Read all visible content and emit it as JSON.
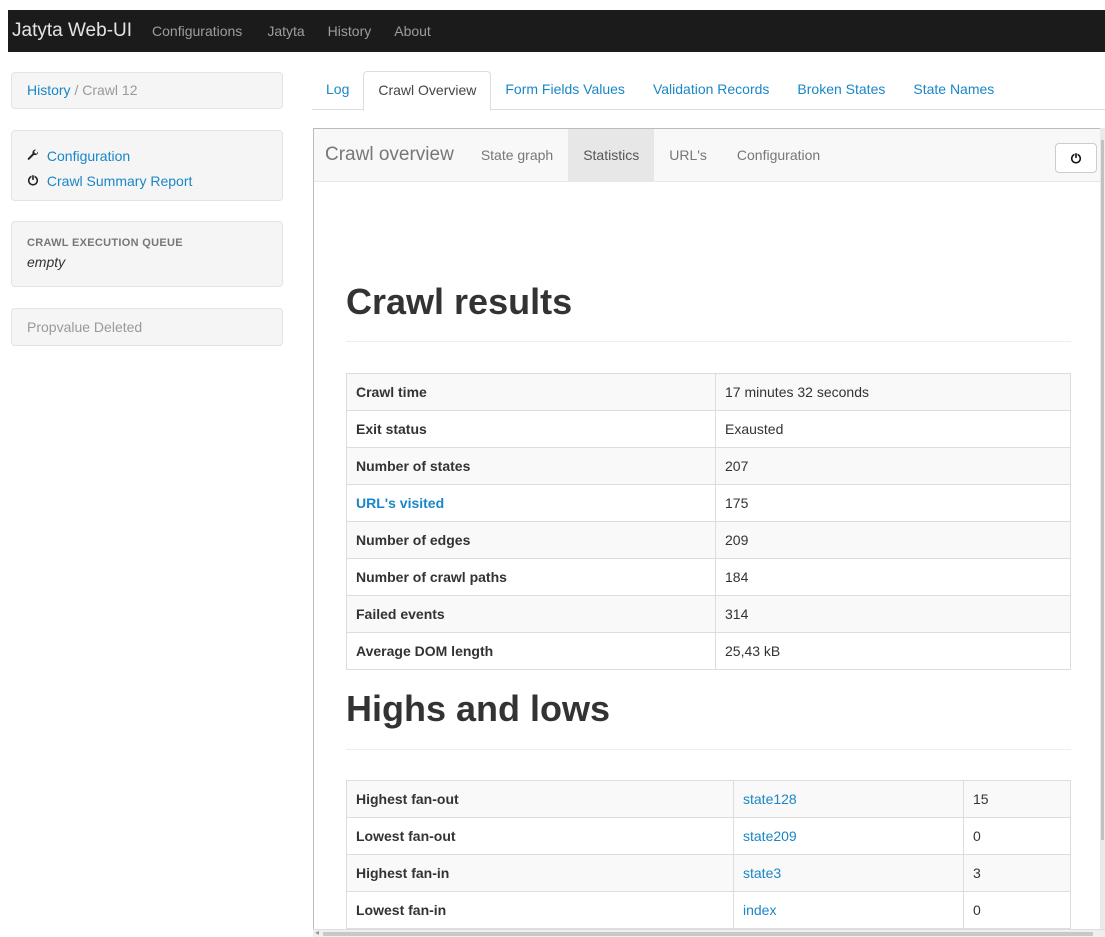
{
  "navbar": {
    "brand": "Jatyta Web-UI",
    "links": [
      "Configurations",
      "Jatyta",
      "History",
      "About"
    ]
  },
  "sidebar": {
    "breadcrumb": {
      "link": "History",
      "separator": "/",
      "current": "Crawl 12"
    },
    "links": [
      {
        "icon": "wrench-icon",
        "label": "Configuration"
      },
      {
        "icon": "power-icon",
        "label": "Crawl Summary Report"
      }
    ],
    "queue": {
      "header": "CRAWL EXECUTION QUEUE",
      "value": "empty"
    },
    "status_message": "Propvalue Deleted"
  },
  "tabs": [
    "Log",
    "Crawl Overview",
    "Form Fields Values",
    "Validation Records",
    "Broken States",
    "State Names"
  ],
  "active_tab": "Crawl Overview",
  "panel": {
    "brand": "Crawl overview",
    "nav": [
      "State graph",
      "Statistics",
      "URL's",
      "Configuration"
    ],
    "active_nav": "Statistics",
    "power_button_icon": "power-icon"
  },
  "crawl_results": {
    "heading": "Crawl results",
    "rows": [
      {
        "label": "Crawl time",
        "value": "17 minutes 32 seconds",
        "link": false
      },
      {
        "label": "Exit status",
        "value": "Exausted",
        "link": false
      },
      {
        "label": "Number of states",
        "value": "207",
        "link": false
      },
      {
        "label": "URL's visited",
        "value": "175",
        "link": true
      },
      {
        "label": "Number of edges",
        "value": "209",
        "link": false
      },
      {
        "label": "Number of crawl paths",
        "value": "184",
        "link": false
      },
      {
        "label": "Failed events",
        "value": "314",
        "link": false
      },
      {
        "label": "Average DOM length",
        "value": "25,43 kB",
        "link": false
      }
    ]
  },
  "highs_lows": {
    "heading": "Highs and lows",
    "rows": [
      {
        "label": "Highest fan-out",
        "state": "state128",
        "value": "15"
      },
      {
        "label": "Lowest fan-out",
        "state": "state209",
        "value": "0"
      },
      {
        "label": "Highest fan-in",
        "state": "state3",
        "value": "3"
      },
      {
        "label": "Lowest fan-in",
        "state": "index",
        "value": "0"
      }
    ]
  },
  "colors": {
    "link": "#1a86c7",
    "navbar_bg": "#1b1b1b"
  }
}
